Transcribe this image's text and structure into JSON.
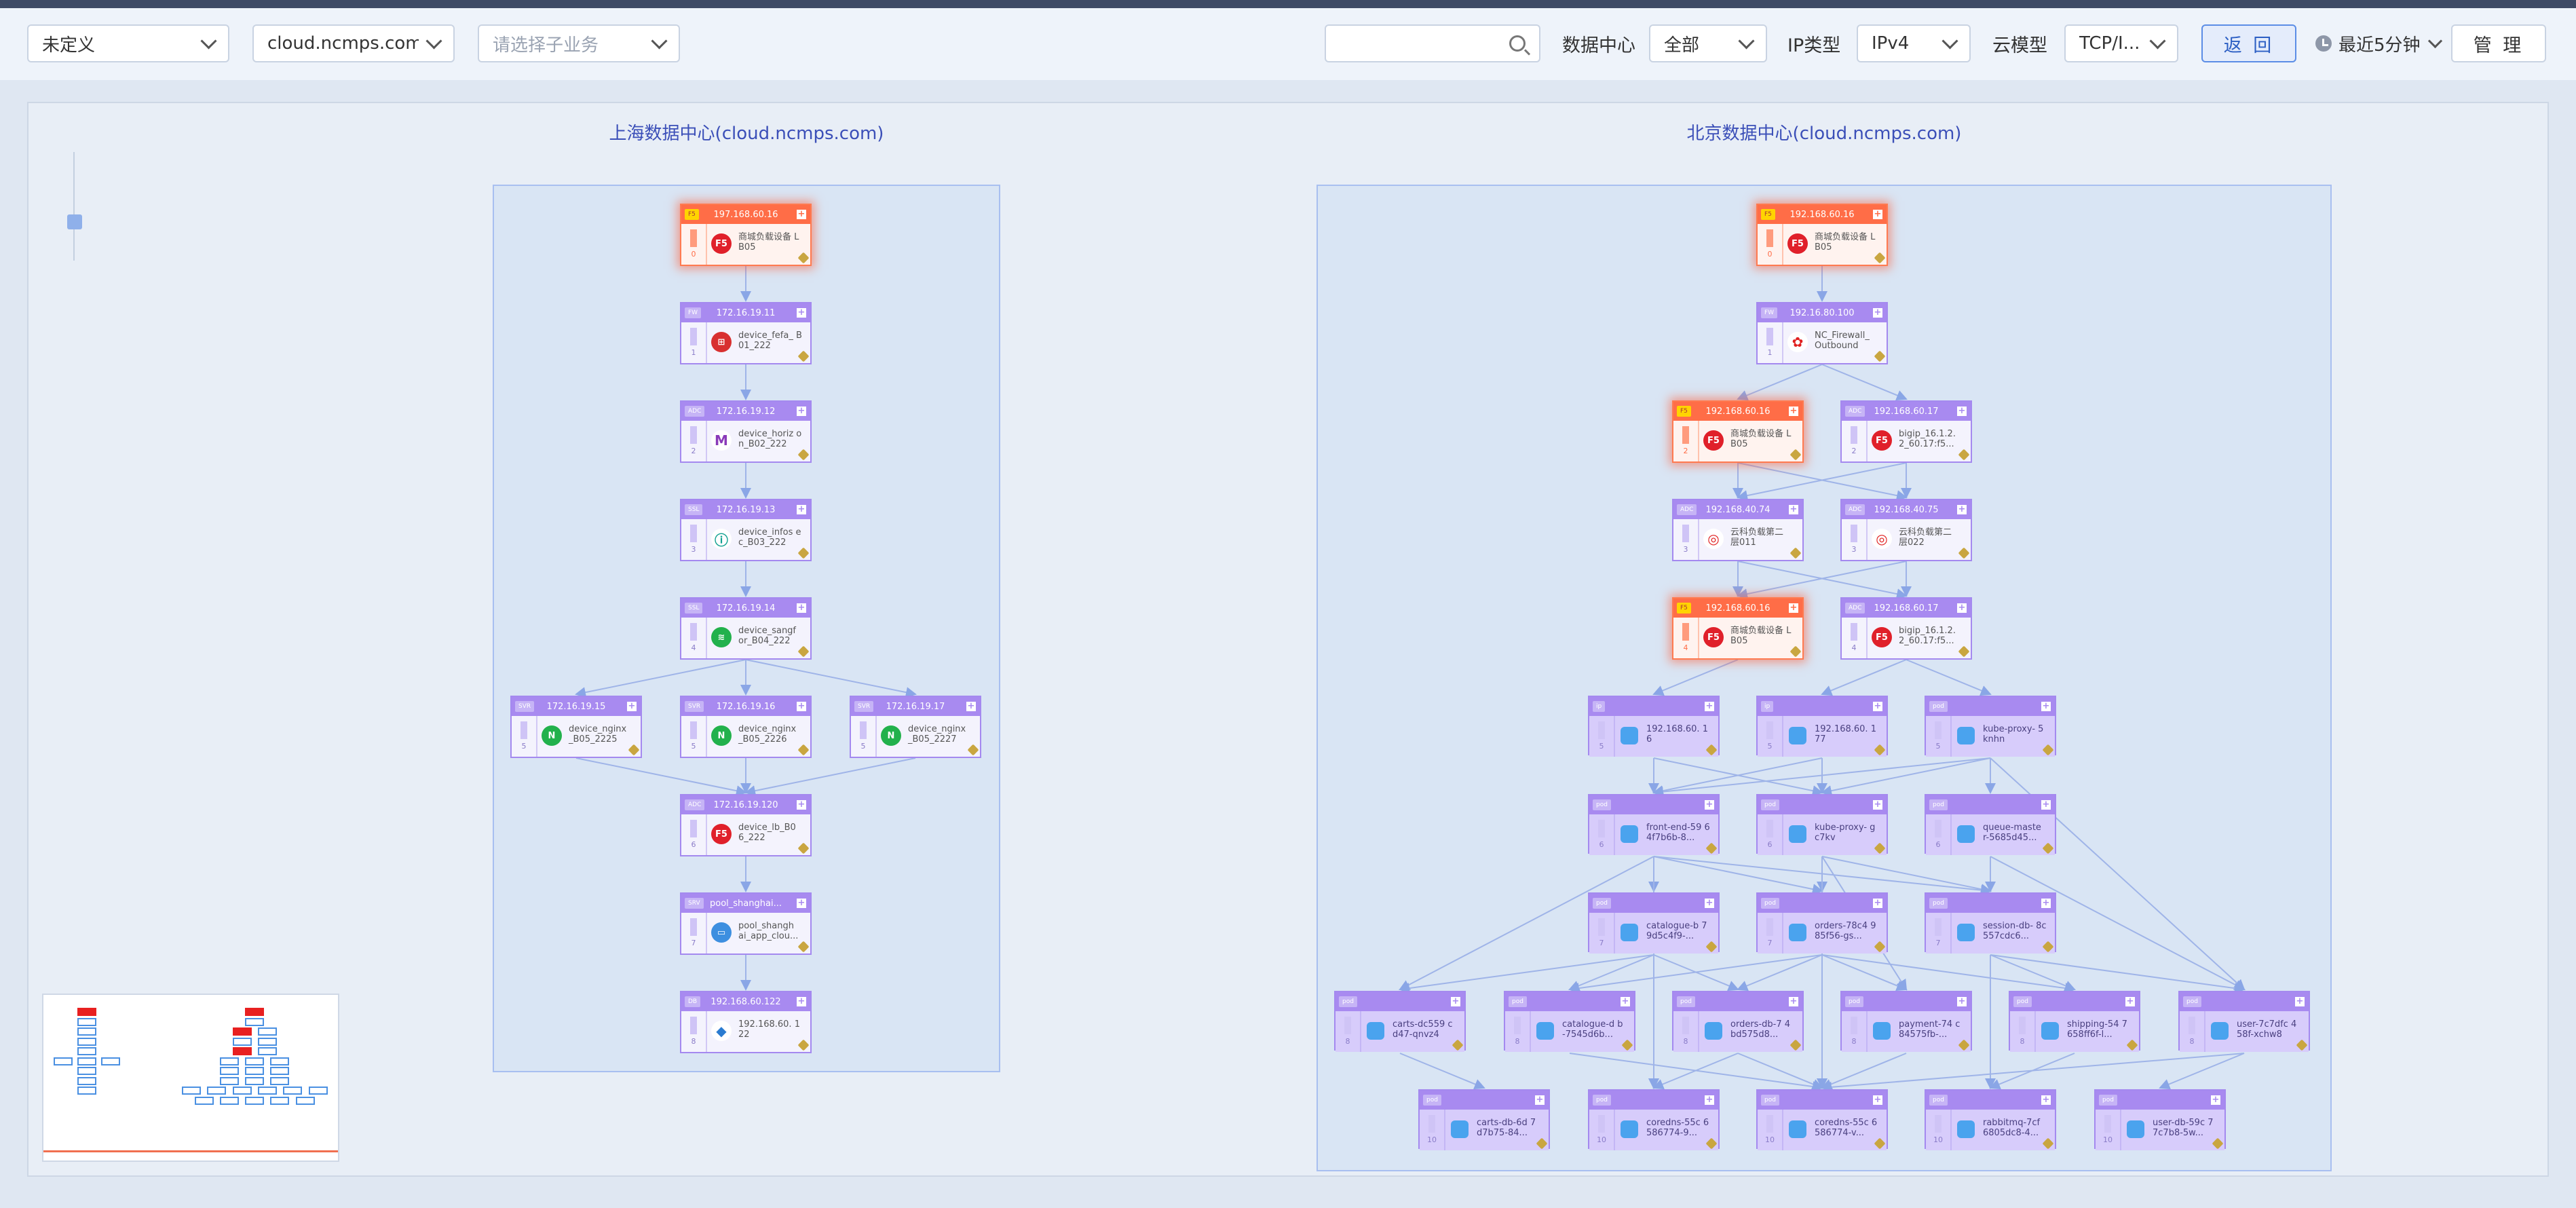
{
  "toolbar": {
    "category": "未定义",
    "domain": "cloud.ncmps.com",
    "sub_business_placeholder": "请选择子业务",
    "search_value": "",
    "datacenter_label": "数据中心",
    "datacenter_value": "全部",
    "ip_type_label": "IP类型",
    "ip_type_value": "IPv4",
    "cloud_model_label": "云模型",
    "cloud_model_value": "TCP/I...",
    "back_label": "返 回",
    "time_range": "最近5分钟",
    "manage_label": "管 理"
  },
  "colors": {
    "accent": "#a88af0",
    "alert": "#ff6d47",
    "region_border": "#a8bff0",
    "title": "#3b4fb8"
  },
  "regions": [
    {
      "title": "上海数据中心(cloud.ncmps.com)"
    },
    {
      "title": "北京数据中心(cloud.ncmps.com)"
    }
  ],
  "nodes": [
    {
      "id": "s0",
      "region": 0,
      "ip": "197.168.60.16",
      "tag": "F5",
      "level": "0",
      "name": "商城负载设备 LB05",
      "icon": "f5",
      "alert": true
    },
    {
      "id": "s1",
      "region": 0,
      "ip": "172.16.19.11",
      "tag": "FW",
      "level": "1",
      "name": "device_fefa_ B01_222",
      "icon": "firewall"
    },
    {
      "id": "s2",
      "region": 0,
      "ip": "172.16.19.12",
      "tag": "ADC",
      "level": "2",
      "name": "device_horiz on_B02_222",
      "icon": "horizon"
    },
    {
      "id": "s3",
      "region": 0,
      "ip": "172.16.19.13",
      "tag": "SSL",
      "level": "3",
      "name": "device_infos ec_B03_222",
      "icon": "infosec"
    },
    {
      "id": "s4",
      "region": 0,
      "ip": "172.16.19.14",
      "tag": "SSL",
      "level": "4",
      "name": "device_sangf or_B04_222",
      "icon": "sangfor"
    },
    {
      "id": "s5a",
      "region": 0,
      "ip": "172.16.19.15",
      "tag": "SVR",
      "level": "5",
      "name": "device_nginx _B05_2225",
      "icon": "nginx"
    },
    {
      "id": "s5b",
      "region": 0,
      "ip": "172.16.19.16",
      "tag": "SVR",
      "level": "5",
      "name": "device_nginx _B05_2226",
      "icon": "nginx"
    },
    {
      "id": "s5c",
      "region": 0,
      "ip": "172.16.19.17",
      "tag": "SVR",
      "level": "5",
      "name": "device_nginx _B05_2227",
      "icon": "nginx"
    },
    {
      "id": "s6",
      "region": 0,
      "ip": "172.16.19.120",
      "tag": "ADC",
      "level": "6",
      "name": "device_lb_B0 6_222",
      "icon": "f5"
    },
    {
      "id": "s7",
      "region": 0,
      "ip": "pool_shanghai...",
      "tag": "SRV",
      "level": "7",
      "name": "pool_shangh ai_app_clou...",
      "icon": "pool"
    },
    {
      "id": "s8",
      "region": 0,
      "ip": "192.168.60.122",
      "tag": "DB",
      "level": "8",
      "name": "192.168.60. 122",
      "icon": "mysql"
    },
    {
      "id": "b0",
      "region": 1,
      "ip": "192.168.60.16",
      "tag": "F5",
      "level": "0",
      "name": "商城负载设备 LB05",
      "icon": "f5",
      "alert": true
    },
    {
      "id": "b1",
      "region": 1,
      "ip": "192.16.80.100",
      "tag": "FW",
      "level": "1",
      "name": "NC_Firewall_ Outbound",
      "icon": "huawei"
    },
    {
      "id": "b2a",
      "region": 1,
      "ip": "192.168.60.16",
      "tag": "F5",
      "level": "2",
      "name": "商城负载设备 LB05",
      "icon": "f5",
      "alert": true
    },
    {
      "id": "b2b",
      "region": 1,
      "ip": "192.168.60.17",
      "tag": "ADC",
      "level": "2",
      "name": "bigip_16.1.2. 2_60.17:f5...",
      "icon": "f5"
    },
    {
      "id": "b3a",
      "region": 1,
      "ip": "192.168.40.74",
      "tag": "ADC",
      "level": "3",
      "name": "云科负载第二 层011",
      "icon": "yunke"
    },
    {
      "id": "b3b",
      "region": 1,
      "ip": "192.168.40.75",
      "tag": "ADC",
      "level": "3",
      "name": "云科负载第二 层022",
      "icon": "yunke"
    },
    {
      "id": "b4a",
      "region": 1,
      "ip": "192.168.60.16",
      "tag": "F5",
      "level": "4",
      "name": "商城负载设备 LB05",
      "icon": "f5",
      "alert": true
    },
    {
      "id": "b4b",
      "region": 1,
      "ip": "192.168.60.17",
      "tag": "ADC",
      "level": "4",
      "name": "bigip_16.1.2. 2_60.17:f5...",
      "icon": "f5"
    },
    {
      "id": "k5a",
      "region": 1,
      "ip": "",
      "tag": "ip",
      "level": "5",
      "name": "192.168.60. 16",
      "icon": "k8s",
      "k8s": true
    },
    {
      "id": "k5b",
      "region": 1,
      "ip": "",
      "tag": "ip",
      "level": "5",
      "name": "192.168.60. 177",
      "icon": "k8s",
      "k8s": true
    },
    {
      "id": "k5c",
      "region": 1,
      "ip": "",
      "tag": "pod",
      "level": "5",
      "name": "kube-proxy- 5knhn",
      "icon": "k8s",
      "k8s": true
    },
    {
      "id": "k6a",
      "region": 1,
      "ip": "",
      "tag": "pod",
      "level": "6",
      "name": "front-end-59 64f7b6b-8...",
      "icon": "k8s",
      "k8s": true
    },
    {
      "id": "k6b",
      "region": 1,
      "ip": "",
      "tag": "pod",
      "level": "6",
      "name": "kube-proxy- gc7kv",
      "icon": "k8s",
      "k8s": true
    },
    {
      "id": "k6c",
      "region": 1,
      "ip": "",
      "tag": "pod",
      "level": "6",
      "name": "queue-maste r-5685d45...",
      "icon": "k8s",
      "k8s": true
    },
    {
      "id": "k7a",
      "region": 1,
      "ip": "",
      "tag": "pod",
      "level": "7",
      "name": "catalogue-b 79d5c4f9-...",
      "icon": "k8s",
      "k8s": true
    },
    {
      "id": "k7b",
      "region": 1,
      "ip": "",
      "tag": "pod",
      "level": "7",
      "name": "orders-78c4 985f56-gs...",
      "icon": "k8s",
      "k8s": true
    },
    {
      "id": "k7c",
      "region": 1,
      "ip": "",
      "tag": "pod",
      "level": "7",
      "name": "session-db- 8c557cdc6...",
      "icon": "k8s",
      "k8s": true
    },
    {
      "id": "k8a",
      "region": 1,
      "ip": "",
      "tag": "pod",
      "level": "8",
      "name": "carts-dc559 cd47-qnvz4",
      "icon": "k8s",
      "k8s": true
    },
    {
      "id": "k8b",
      "region": 1,
      "ip": "",
      "tag": "pod",
      "level": "8",
      "name": "catalogue-d b-7545d6b...",
      "icon": "k8s",
      "k8s": true
    },
    {
      "id": "k8c",
      "region": 1,
      "ip": "",
      "tag": "pod",
      "level": "8",
      "name": "orders-db-7 4bd575d8...",
      "icon": "k8s",
      "k8s": true
    },
    {
      "id": "k8d",
      "region": 1,
      "ip": "",
      "tag": "pod",
      "level": "8",
      "name": "payment-74 c84575fb-...",
      "icon": "k8s",
      "k8s": true
    },
    {
      "id": "k8e",
      "region": 1,
      "ip": "",
      "tag": "pod",
      "level": "8",
      "name": "shipping-54 7658ff6f-l...",
      "icon": "k8s",
      "k8s": true
    },
    {
      "id": "k8f",
      "region": 1,
      "ip": "",
      "tag": "pod",
      "level": "8",
      "name": "user-7c7dfc 458f-xchw8",
      "icon": "k8s",
      "k8s": true
    },
    {
      "id": "k9a",
      "region": 1,
      "ip": "",
      "tag": "pod",
      "level": "10",
      "name": "carts-db-6d 7d7b75-84...",
      "icon": "k8s",
      "k8s": true
    },
    {
      "id": "k9b",
      "region": 1,
      "ip": "",
      "tag": "pod",
      "level": "10",
      "name": "coredns-55c 6586774-9...",
      "icon": "k8s",
      "k8s": true
    },
    {
      "id": "k9c",
      "region": 1,
      "ip": "",
      "tag": "pod",
      "level": "10",
      "name": "coredns-55c 6586774-v...",
      "icon": "k8s",
      "k8s": true
    },
    {
      "id": "k9d",
      "region": 1,
      "ip": "",
      "tag": "pod",
      "level": "10",
      "name": "rabbitmq-7cf 6805dc8-4...",
      "icon": "k8s",
      "k8s": true
    },
    {
      "id": "k9e",
      "region": 1,
      "ip": "",
      "tag": "pod",
      "level": "10",
      "name": "user-db-59c 77c7b8-5w...",
      "icon": "k8s",
      "k8s": true
    }
  ],
  "links": [
    [
      "s0",
      "s1"
    ],
    [
      "s1",
      "s2"
    ],
    [
      "s2",
      "s3"
    ],
    [
      "s3",
      "s4"
    ],
    [
      "s4",
      "s5a"
    ],
    [
      "s4",
      "s5b"
    ],
    [
      "s4",
      "s5c"
    ],
    [
      "s5a",
      "s6"
    ],
    [
      "s5b",
      "s6"
    ],
    [
      "s5c",
      "s6"
    ],
    [
      "s6",
      "s7"
    ],
    [
      "s7",
      "s8"
    ],
    [
      "b0",
      "b1"
    ],
    [
      "b1",
      "b2a"
    ],
    [
      "b1",
      "b2b"
    ],
    [
      "b2a",
      "b3a"
    ],
    [
      "b2a",
      "b3b"
    ],
    [
      "b2b",
      "b3a"
    ],
    [
      "b2b",
      "b3b"
    ],
    [
      "b3a",
      "b4a"
    ],
    [
      "b3a",
      "b4b"
    ],
    [
      "b3b",
      "b4a"
    ],
    [
      "b3b",
      "b4b"
    ],
    [
      "b4a",
      "k5a"
    ],
    [
      "b4b",
      "k5b"
    ],
    [
      "b4b",
      "k5c"
    ],
    [
      "k5a",
      "k6a"
    ],
    [
      "k5b",
      "k6a"
    ],
    [
      "k5c",
      "k6a"
    ],
    [
      "k5c",
      "k6b"
    ],
    [
      "k5c",
      "k6c"
    ],
    [
      "k5b",
      "k6b"
    ],
    [
      "k5a",
      "k6b"
    ],
    [
      "k6a",
      "k7a"
    ],
    [
      "k6a",
      "k7b"
    ],
    [
      "k6a",
      "k7c"
    ],
    [
      "k6b",
      "k7b"
    ],
    [
      "k6b",
      "k7c"
    ],
    [
      "k6c",
      "k7c"
    ],
    [
      "k6a",
      "k8a"
    ],
    [
      "k6b",
      "k8d"
    ],
    [
      "k6c",
      "k8f"
    ],
    [
      "k5c",
      "k8f"
    ],
    [
      "k7a",
      "k8a"
    ],
    [
      "k7a",
      "k8b"
    ],
    [
      "k7b",
      "k8c"
    ],
    [
      "k7b",
      "k8d"
    ],
    [
      "k7b",
      "k8e"
    ],
    [
      "k7c",
      "k8f"
    ],
    [
      "k7a",
      "k8c"
    ],
    [
      "k7c",
      "k8e"
    ],
    [
      "k7b",
      "k8b"
    ],
    [
      "k8a",
      "k9a"
    ],
    [
      "k8c",
      "k9b"
    ],
    [
      "k8c",
      "k9c"
    ],
    [
      "k8d",
      "k9c"
    ],
    [
      "k8e",
      "k9d"
    ],
    [
      "k8f",
      "k9e"
    ],
    [
      "k8f",
      "k9c"
    ],
    [
      "k7a",
      "k9b"
    ],
    [
      "k7b",
      "k9c"
    ],
    [
      "k7c",
      "k9d"
    ],
    [
      "k6a",
      "k9b"
    ],
    [
      "k6b",
      "k9c"
    ],
    [
      "k8b",
      "k9c"
    ]
  ],
  "minimap": {
    "label": ""
  }
}
